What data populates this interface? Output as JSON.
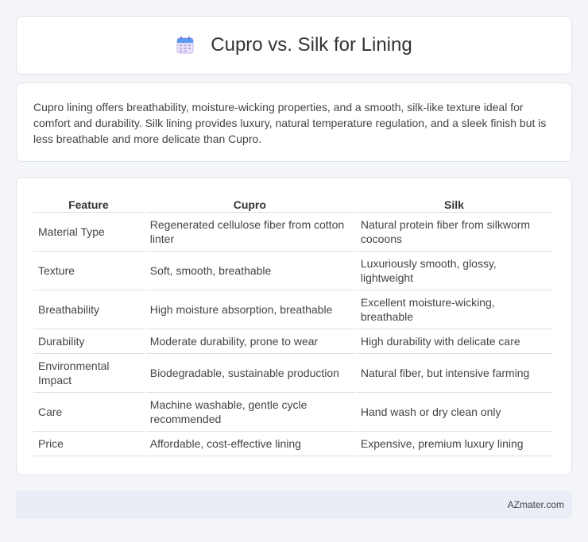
{
  "header": {
    "title": "Cupro vs. Silk for Lining",
    "icon": "calendar-icon"
  },
  "summary": {
    "text": "Cupro lining offers breathability, moisture-wicking properties, and a smooth, silk-like texture ideal for comfort and durability. Silk lining provides luxury, natural temperature regulation, and a sleek finish but is less breathable and more delicate than Cupro."
  },
  "table": {
    "headers": [
      "Feature",
      "Cupro",
      "Silk"
    ],
    "rows": [
      [
        "Material Type",
        "Regenerated cellulose fiber from cotton linter",
        "Natural protein fiber from silkworm cocoons"
      ],
      [
        "Texture",
        "Soft, smooth, breathable",
        "Luxuriously smooth, glossy, lightweight"
      ],
      [
        "Breathability",
        "High moisture absorption, breathable",
        "Excellent moisture-wicking, breathable"
      ],
      [
        "Durability",
        "Moderate durability, prone to wear",
        "High durability with delicate care"
      ],
      [
        "Environmental Impact",
        "Biodegradable, sustainable production",
        "Natural fiber, but intensive farming"
      ],
      [
        "Care",
        "Machine washable, gentle cycle recommended",
        "Hand wash or dry clean only"
      ],
      [
        "Price",
        "Affordable, cost-effective lining",
        "Expensive, premium luxury lining"
      ]
    ]
  },
  "footer": {
    "text": "AZmater.com"
  }
}
